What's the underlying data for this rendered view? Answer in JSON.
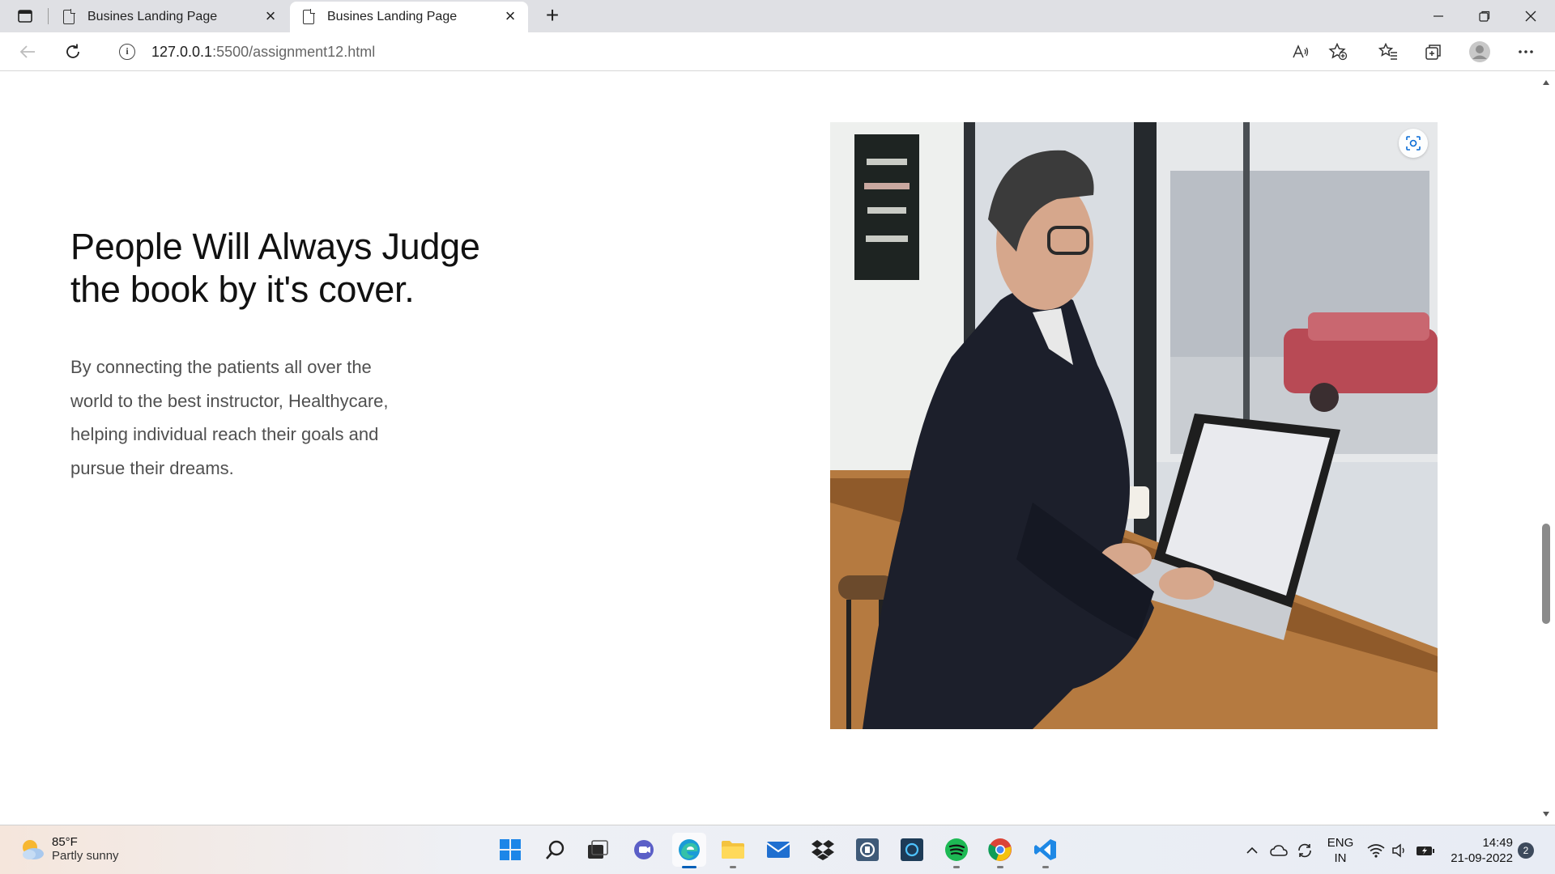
{
  "browser": {
    "tabs": [
      {
        "title": "Busines Landing Page",
        "active": false
      },
      {
        "title": "Busines Landing Page",
        "active": true
      }
    ],
    "url_host": "127.0.0.1",
    "url_path": ":5500/assignment12.html"
  },
  "hero": {
    "headline": "People Will Always Judge the book by it's cover.",
    "body": "By connecting the patients all over the world to the best instructor, Healthycare, helping individual reach their goals and pursue their dreams."
  },
  "taskbar": {
    "weather_temp": "85°F",
    "weather_condition": "Partly sunny",
    "lang_line1": "ENG",
    "lang_line2": "IN",
    "time": "14:49",
    "date": "21-09-2022",
    "notification_count": "2"
  }
}
